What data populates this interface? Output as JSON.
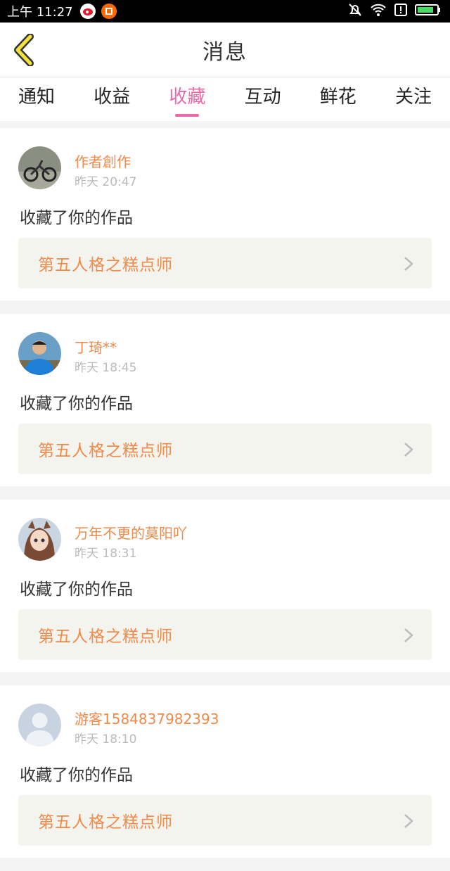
{
  "statusbar": {
    "time": "上午 11:27",
    "app_icons": [
      "weibo-icon",
      "orange-app-icon"
    ],
    "right_icons": [
      "mute-bell-icon",
      "wifi-icon",
      "alert-icon",
      "battery-icon"
    ]
  },
  "header": {
    "title": "消息",
    "back_icon": "back-chevron-icon"
  },
  "tabs": [
    {
      "label": "通知"
    },
    {
      "label": "收益"
    },
    {
      "label": "收藏",
      "active": true
    },
    {
      "label": "互动"
    },
    {
      "label": "鲜花"
    },
    {
      "label": "关注"
    }
  ],
  "items": [
    {
      "user": "作者創作",
      "time": "昨天 20:47",
      "action": "收藏了你的作品",
      "work": "第五人格之糕点师"
    },
    {
      "user": "丁琦**",
      "time": "昨天 18:45",
      "action": "收藏了你的作品",
      "work": "第五人格之糕点师"
    },
    {
      "user": "万年不更的莫阳吖",
      "time": "昨天 18:31",
      "action": "收藏了你的作品",
      "work": "第五人格之糕点师"
    },
    {
      "user": "游客1584837982393",
      "time": "昨天 18:10",
      "action": "收藏了你的作品",
      "work": "第五人格之糕点师"
    }
  ],
  "colors": {
    "accent_pink": "#e96aa6",
    "username_orange": "#f08a4b",
    "back_icon_yellow": "#f4e13c"
  }
}
